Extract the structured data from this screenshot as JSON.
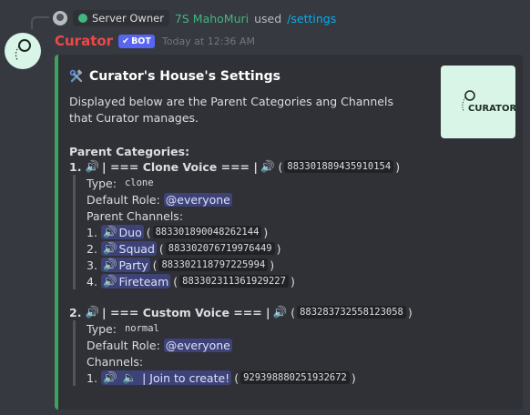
{
  "reply": {
    "role": "Server Owner",
    "user": "7S MahoMuri",
    "verb": "used",
    "command": "/settings"
  },
  "message": {
    "author": "Curator",
    "bot_tag": "BOT",
    "timestamp": "Today at 12:36 AM"
  },
  "embed": {
    "accent_color": "#3ba55d",
    "title": "Curator's House's Settings",
    "title_icon": "hammer-wrench-icon",
    "description": "Displayed below are the Parent Categories ang Channels that Curator manages.",
    "thumbnail_text": "CURATOR",
    "section_title": "Parent Categories:",
    "labels": {
      "type": "Type:",
      "default_role": "Default Role:",
      "parent_channels": "Parent Channels:",
      "channels": "Channels:"
    },
    "categories": [
      {
        "num": "1.",
        "name": "| === Clone Voice === |",
        "id": "883301889435910154",
        "type": "clone",
        "role": "@everyone",
        "channels": [
          {
            "num": "1.",
            "name": "Duo",
            "id": "883301890048262144"
          },
          {
            "num": "2.",
            "name": "Squad",
            "id": "883302076719976449"
          },
          {
            "num": "3.",
            "name": "Party",
            "id": "883302118797225994"
          },
          {
            "num": "4.",
            "name": "Fireteam",
            "id": "883302311361929227"
          }
        ]
      },
      {
        "num": "2.",
        "name": "| === Custom Voice === |",
        "id": "883283732558123058",
        "type": "normal",
        "role": "@everyone",
        "channels": [
          {
            "num": "1.",
            "name": "| Join to create!",
            "id": "929398880251932672"
          }
        ]
      }
    ]
  },
  "colors": {
    "background": "#36393f",
    "embed_bg": "#2f3136",
    "author": "#f04747",
    "bot_tag": "#5865f2",
    "role_green": "#43b581",
    "command_blue": "#00aff4"
  }
}
